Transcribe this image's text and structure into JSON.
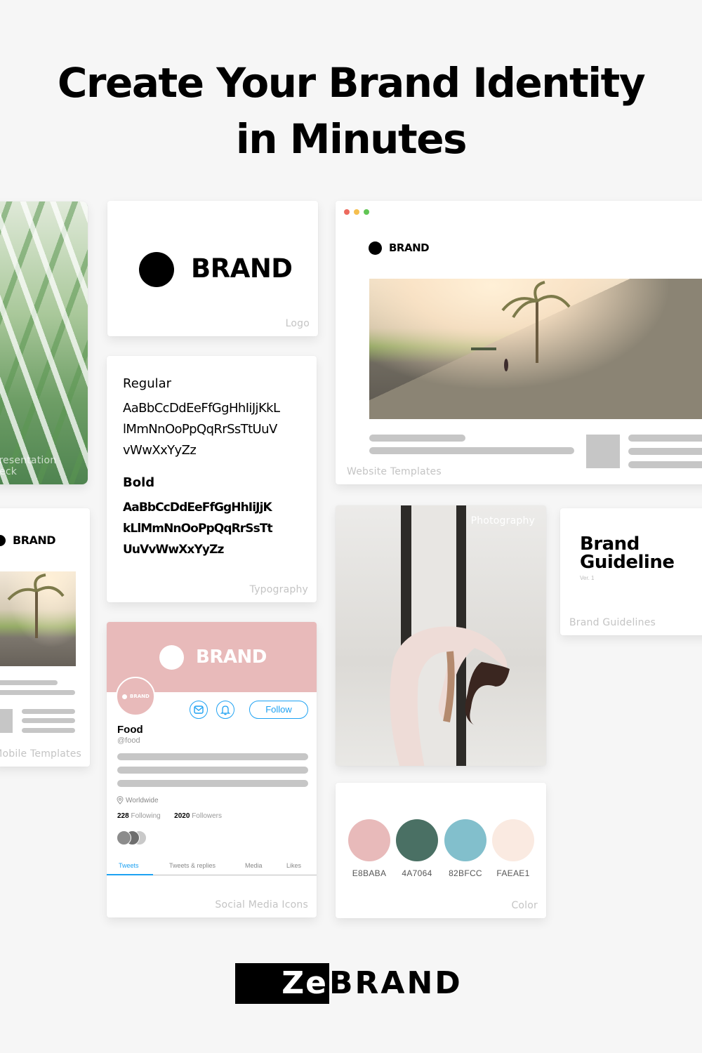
{
  "headline": {
    "line1": "Create Your Brand Identity",
    "line2": "in Minutes"
  },
  "cards": {
    "presentation": {
      "label": "Presentation deck"
    },
    "logo": {
      "brand": "BRAND",
      "label": "Logo"
    },
    "typography": {
      "regular_heading": "Regular",
      "regular_lines": [
        "AaBbCcDdEeFfGgHhIiJjKkL",
        "lMmNnOoPpQqRrSsTtUuV",
        "vWwXxYyZz"
      ],
      "bold_heading": "Bold",
      "bold_lines": [
        "AaBbCcDdEeFfGgHhIiJjK",
        "kLlMmNnOoPpQqRrSsTt",
        "UuVvWwXxYyZz"
      ],
      "label": "Typography"
    },
    "website": {
      "brand": "BRAND",
      "label": "Website Templates"
    },
    "mobile": {
      "brand": "BRAND",
      "label": "Mobile Templates"
    },
    "social": {
      "banner_brand": "BRAND",
      "avatar_brand": "BRAND",
      "follow_label": "Follow",
      "name": "Food",
      "handle": "@food",
      "location": "Worldwide",
      "following_count": "228",
      "following_label": "Following",
      "followers_count": "2020",
      "followers_label": "Followers",
      "tabs": [
        "Tweets",
        "Tweets & replies",
        "Media",
        "Likes"
      ],
      "active_tab": "Tweets",
      "accent": "#1da1f2",
      "icons": [
        "mail-icon",
        "bell-icon",
        "location-pin-icon"
      ],
      "label": "Social Media Icons"
    },
    "photography": {
      "label": "Photography"
    },
    "guideline": {
      "title_line1": "Brand",
      "title_line2": "Guideline",
      "version": "Ver. 1",
      "label": "Brand Guidelines"
    },
    "color": {
      "swatches": [
        {
          "hex": "#E8BABA",
          "label": "E8BABA"
        },
        {
          "hex": "#4A7064",
          "label": "4A7064"
        },
        {
          "hex": "#82BFCC",
          "label": "82BFCC"
        },
        {
          "hex": "#FAEAE1",
          "label": "FAEAE1"
        }
      ],
      "label": "Color"
    }
  },
  "window_controls": {
    "colors": [
      "#ed6a5e",
      "#f5bf4f",
      "#61c554"
    ]
  },
  "footer": {
    "logo_part1": "Ze",
    "logo_part2": "BRAND"
  }
}
